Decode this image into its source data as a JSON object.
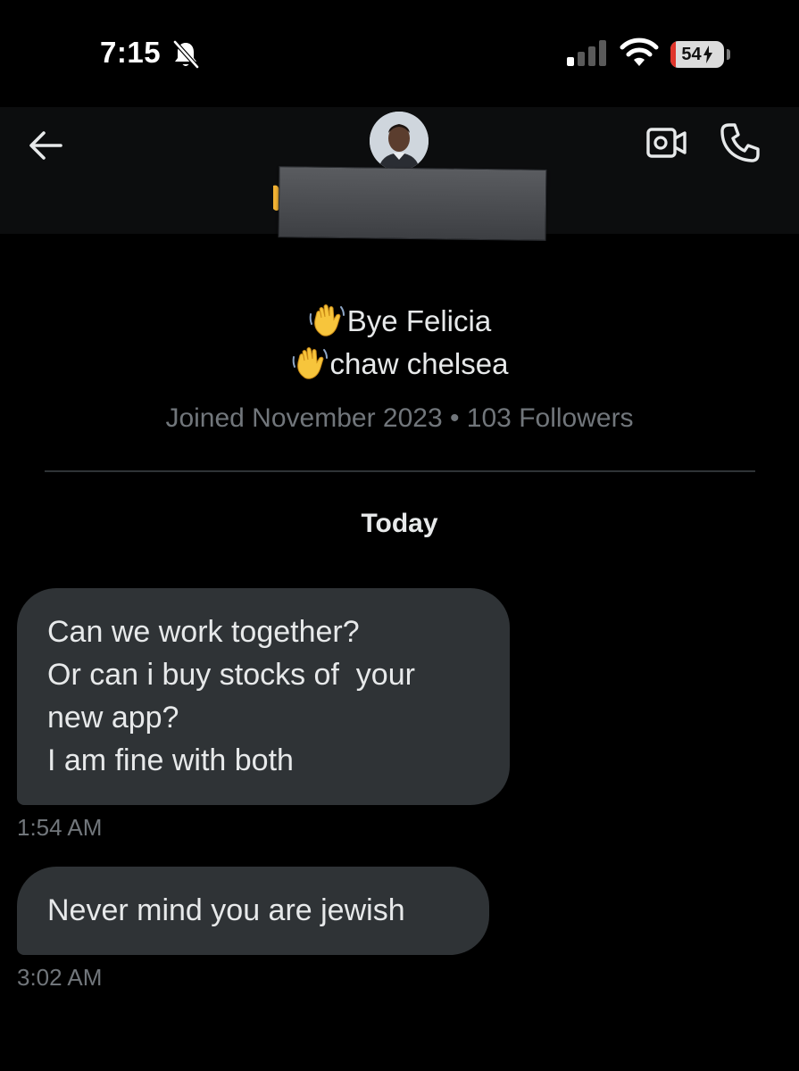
{
  "status_bar": {
    "time": "7:15",
    "battery_level": "54",
    "icons": [
      "bell-muted-icon",
      "cellular-signal-icon",
      "wifi-icon",
      "battery-charging-icon"
    ]
  },
  "header": {
    "icons": [
      "back-arrow-icon",
      "avatar",
      "video-call-icon",
      "phone-call-icon"
    ],
    "name_redacted": true
  },
  "profile": {
    "bio_lines": [
      {
        "emoji": "waving-hand-icon",
        "text": "Bye Felicia"
      },
      {
        "emoji": "waving-hand-icon",
        "text": "chaw chelsea"
      }
    ],
    "joined_info": "Joined November 2023 • 103 Followers"
  },
  "conversation": {
    "date_label": "Today",
    "messages": [
      {
        "lines": [
          "Can we work together?",
          "Or can i buy stocks of  your",
          "new app?",
          "I am fine with both"
        ],
        "timestamp": "1:54 AM"
      },
      {
        "lines": [
          "Never mind you are jewish"
        ],
        "timestamp": "3:02 AM"
      }
    ]
  },
  "colors": {
    "background": "#000000",
    "header_bg": "#0c0d0e",
    "bubble_bg": "#2f3336",
    "text_primary": "#e7e9ea",
    "text_secondary": "#71767b",
    "battery_low": "#e0352b"
  }
}
